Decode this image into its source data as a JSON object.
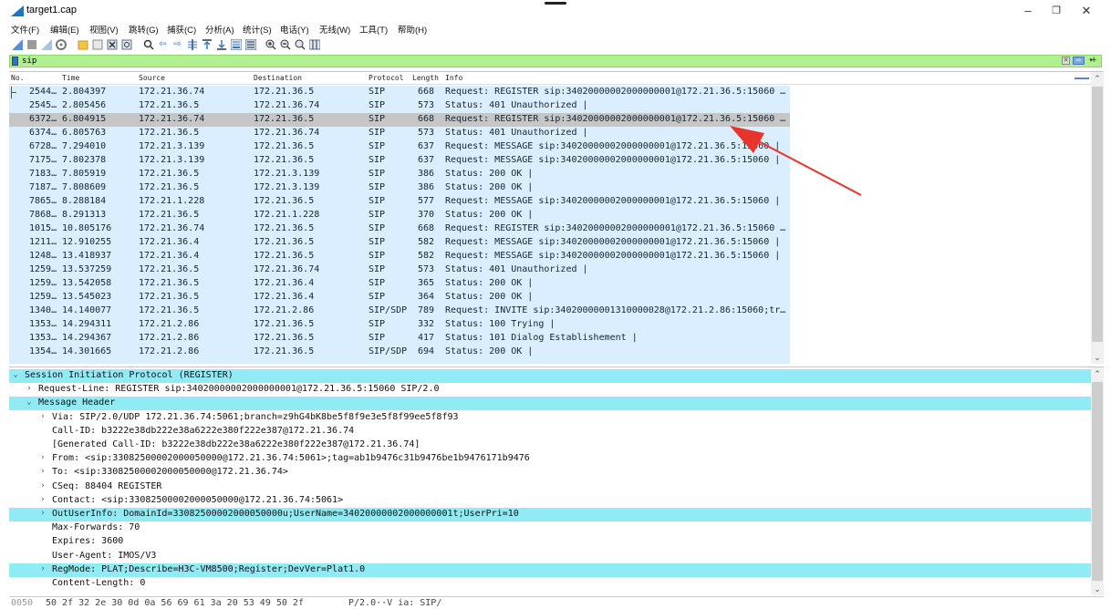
{
  "window": {
    "title": "target1.cap",
    "minimize": "–",
    "restore": "❐",
    "close": "✕"
  },
  "menu": [
    {
      "label": "文件(F)"
    },
    {
      "label": "编辑(E)"
    },
    {
      "label": "视图(V)"
    },
    {
      "label": "跳转(G)"
    },
    {
      "label": "捕获(C)"
    },
    {
      "label": "分析(A)"
    },
    {
      "label": "统计(S)"
    },
    {
      "label": "电话(Y)"
    },
    {
      "label": "无线(W)"
    },
    {
      "label": "工具(T)"
    },
    {
      "label": "帮助(H)"
    }
  ],
  "filter": {
    "value": "sip",
    "clear": "✕",
    "apply": "⇨",
    "dropdown": "▾",
    "plus": "+"
  },
  "columns": [
    {
      "key": "no",
      "label": "No."
    },
    {
      "key": "time",
      "label": "Time"
    },
    {
      "key": "source",
      "label": "Source"
    },
    {
      "key": "destination",
      "label": "Destination"
    },
    {
      "key": "protocol",
      "label": "Protocol"
    },
    {
      "key": "length",
      "label": "Length"
    },
    {
      "key": "info",
      "label": "Info"
    }
  ],
  "packets": [
    {
      "no": "2544…",
      "time": "2.804397",
      "source": "172.21.36.74",
      "destination": "172.21.36.5",
      "protocol": "SIP",
      "length": "668",
      "info": "Request: REGISTER sip:34020000002000000001@172.21.36.5:15060 …"
    },
    {
      "no": "2545…",
      "time": "2.805456",
      "source": "172.21.36.5",
      "destination": "172.21.36.74",
      "protocol": "SIP",
      "length": "573",
      "info": "Status: 401 Unauthorized |"
    },
    {
      "no": "6372…",
      "time": "6.804915",
      "source": "172.21.36.74",
      "destination": "172.21.36.5",
      "protocol": "SIP",
      "length": "668",
      "info": "Request: REGISTER sip:34020000002000000001@172.21.36.5:15060 …"
    },
    {
      "no": "6374…",
      "time": "6.805763",
      "source": "172.21.36.5",
      "destination": "172.21.36.74",
      "protocol": "SIP",
      "length": "573",
      "info": "Status: 401 Unauthorized |"
    },
    {
      "no": "6728…",
      "time": "7.294010",
      "source": "172.21.3.139",
      "destination": "172.21.36.5",
      "protocol": "SIP",
      "length": "637",
      "info": "Request: MESSAGE sip:34020000002000000001@172.21.36.5:15060 |"
    },
    {
      "no": "7175…",
      "time": "7.802378",
      "source": "172.21.3.139",
      "destination": "172.21.36.5",
      "protocol": "SIP",
      "length": "637",
      "info": "Request: MESSAGE sip:34020000002000000001@172.21.36.5:15060 |"
    },
    {
      "no": "7183…",
      "time": "7.805919",
      "source": "172.21.36.5",
      "destination": "172.21.3.139",
      "protocol": "SIP",
      "length": "386",
      "info": "Status: 200 OK |"
    },
    {
      "no": "7187…",
      "time": "7.808609",
      "source": "172.21.36.5",
      "destination": "172.21.3.139",
      "protocol": "SIP",
      "length": "386",
      "info": "Status: 200 OK |"
    },
    {
      "no": "7865…",
      "time": "8.288184",
      "source": "172.21.1.228",
      "destination": "172.21.36.5",
      "protocol": "SIP",
      "length": "577",
      "info": "Request: MESSAGE sip:34020000002000000001@172.21.36.5:15060 |"
    },
    {
      "no": "7868…",
      "time": "8.291313",
      "source": "172.21.36.5",
      "destination": "172.21.1.228",
      "protocol": "SIP",
      "length": "370",
      "info": "Status: 200 OK |"
    },
    {
      "no": "1015…",
      "time": "10.805176",
      "source": "172.21.36.74",
      "destination": "172.21.36.5",
      "protocol": "SIP",
      "length": "668",
      "info": "Request: REGISTER sip:34020000002000000001@172.21.36.5:15060 …"
    },
    {
      "no": "1211…",
      "time": "12.910255",
      "source": "172.21.36.4",
      "destination": "172.21.36.5",
      "protocol": "SIP",
      "length": "582",
      "info": "Request: MESSAGE sip:34020000002000000001@172.21.36.5:15060 |"
    },
    {
      "no": "1248…",
      "time": "13.418937",
      "source": "172.21.36.4",
      "destination": "172.21.36.5",
      "protocol": "SIP",
      "length": "582",
      "info": "Request: MESSAGE sip:34020000002000000001@172.21.36.5:15060 |"
    },
    {
      "no": "1259…",
      "time": "13.537259",
      "source": "172.21.36.5",
      "destination": "172.21.36.74",
      "protocol": "SIP",
      "length": "573",
      "info": "Status: 401 Unauthorized |"
    },
    {
      "no": "1259…",
      "time": "13.542058",
      "source": "172.21.36.5",
      "destination": "172.21.36.4",
      "protocol": "SIP",
      "length": "365",
      "info": "Status: 200 OK |"
    },
    {
      "no": "1259…",
      "time": "13.545023",
      "source": "172.21.36.5",
      "destination": "172.21.36.4",
      "protocol": "SIP",
      "length": "364",
      "info": "Status: 200 OK |"
    },
    {
      "no": "1340…",
      "time": "14.140077",
      "source": "172.21.36.5",
      "destination": "172.21.2.86",
      "protocol": "SIP/SDP",
      "length": "789",
      "info": "Request: INVITE sip:34020000001310000028@172.21.2.86:15060;tr…"
    },
    {
      "no": "1353…",
      "time": "14.294311",
      "source": "172.21.2.86",
      "destination": "172.21.36.5",
      "protocol": "SIP",
      "length": "332",
      "info": "Status: 100 Trying |"
    },
    {
      "no": "1353…",
      "time": "14.294367",
      "source": "172.21.2.86",
      "destination": "172.21.36.5",
      "protocol": "SIP",
      "length": "417",
      "info": "Status: 101 Dialog Establishement |"
    },
    {
      "no": "1354…",
      "time": "14.301665",
      "source": "172.21.2.86",
      "destination": "172.21.36.5",
      "protocol": "SIP/SDP",
      "length": "694",
      "info": "Status: 200 OK |"
    }
  ],
  "selected_row_index": 2,
  "details": [
    {
      "text": "Session Initiation Protocol (REGISTER)",
      "arrow": "⌄",
      "indent": 0,
      "hl": true
    },
    {
      "text": "Request-Line: REGISTER sip:34020000002000000001@172.21.36.5:15060 SIP/2.0",
      "arrow": "›",
      "indent": 1,
      "hl": false
    },
    {
      "text": "Message Header",
      "arrow": "⌄",
      "indent": 1,
      "hl": true
    },
    {
      "text": "Via: SIP/2.0/UDP 172.21.36.74:5061;branch=z9hG4bK8be5f8f9e3e5f8f99ee5f8f93",
      "arrow": "›",
      "indent": 2,
      "hl": false
    },
    {
      "text": "Call-ID: b3222e38db222e38a6222e380f222e387@172.21.36.74",
      "arrow": "",
      "indent": 2,
      "hl": false
    },
    {
      "text": "[Generated Call-ID: b3222e38db222e38a6222e380f222e387@172.21.36.74]",
      "arrow": "",
      "indent": 2,
      "hl": false
    },
    {
      "text": "From: <sip:33082500002000050000@172.21.36.74:5061>;tag=ab1b9476c31b9476be1b9476171b9476",
      "arrow": "›",
      "indent": 2,
      "hl": false
    },
    {
      "text": "To: <sip:33082500002000050000@172.21.36.74>",
      "arrow": "›",
      "indent": 2,
      "hl": false
    },
    {
      "text": "CSeq: 88404 REGISTER",
      "arrow": "›",
      "indent": 2,
      "hl": false
    },
    {
      "text": "Contact: <sip:33082500002000050000@172.21.36.74:5061>",
      "arrow": "›",
      "indent": 2,
      "hl": false
    },
    {
      "text": "OutUserInfo: DomainId=33082500002000050000u;UserName=34020000002000000001t;UserPri=10",
      "arrow": "›",
      "indent": 2,
      "hl": true
    },
    {
      "text": "Max-Forwards: 70",
      "arrow": "",
      "indent": 2,
      "hl": false
    },
    {
      "text": "Expires: 3600",
      "arrow": "",
      "indent": 2,
      "hl": false
    },
    {
      "text": "User-Agent: IMOS/V3",
      "arrow": "",
      "indent": 2,
      "hl": false
    },
    {
      "text": "RegMode: PLAT;Describe=H3C-VM8500;Register;DevVer=Plat1.0",
      "arrow": "›",
      "indent": 2,
      "hl": true
    },
    {
      "text": "Content-Length: 0",
      "arrow": "",
      "indent": 2,
      "hl": false
    }
  ],
  "bytes": {
    "offset": "0050",
    "hex": "50 2f 32 2e 30 0d 0a 56  69 61 3a 20 53 49 50 2f",
    "ascii": "P/2.0··V ia: SIP/"
  },
  "colors": {
    "filter_bg": "#b1f08e",
    "row_bg": "#daeeff",
    "selected_row": "#c6c6c6",
    "detail_highlight": "#90ebf5",
    "annotation_arrow": "#e8342c"
  }
}
